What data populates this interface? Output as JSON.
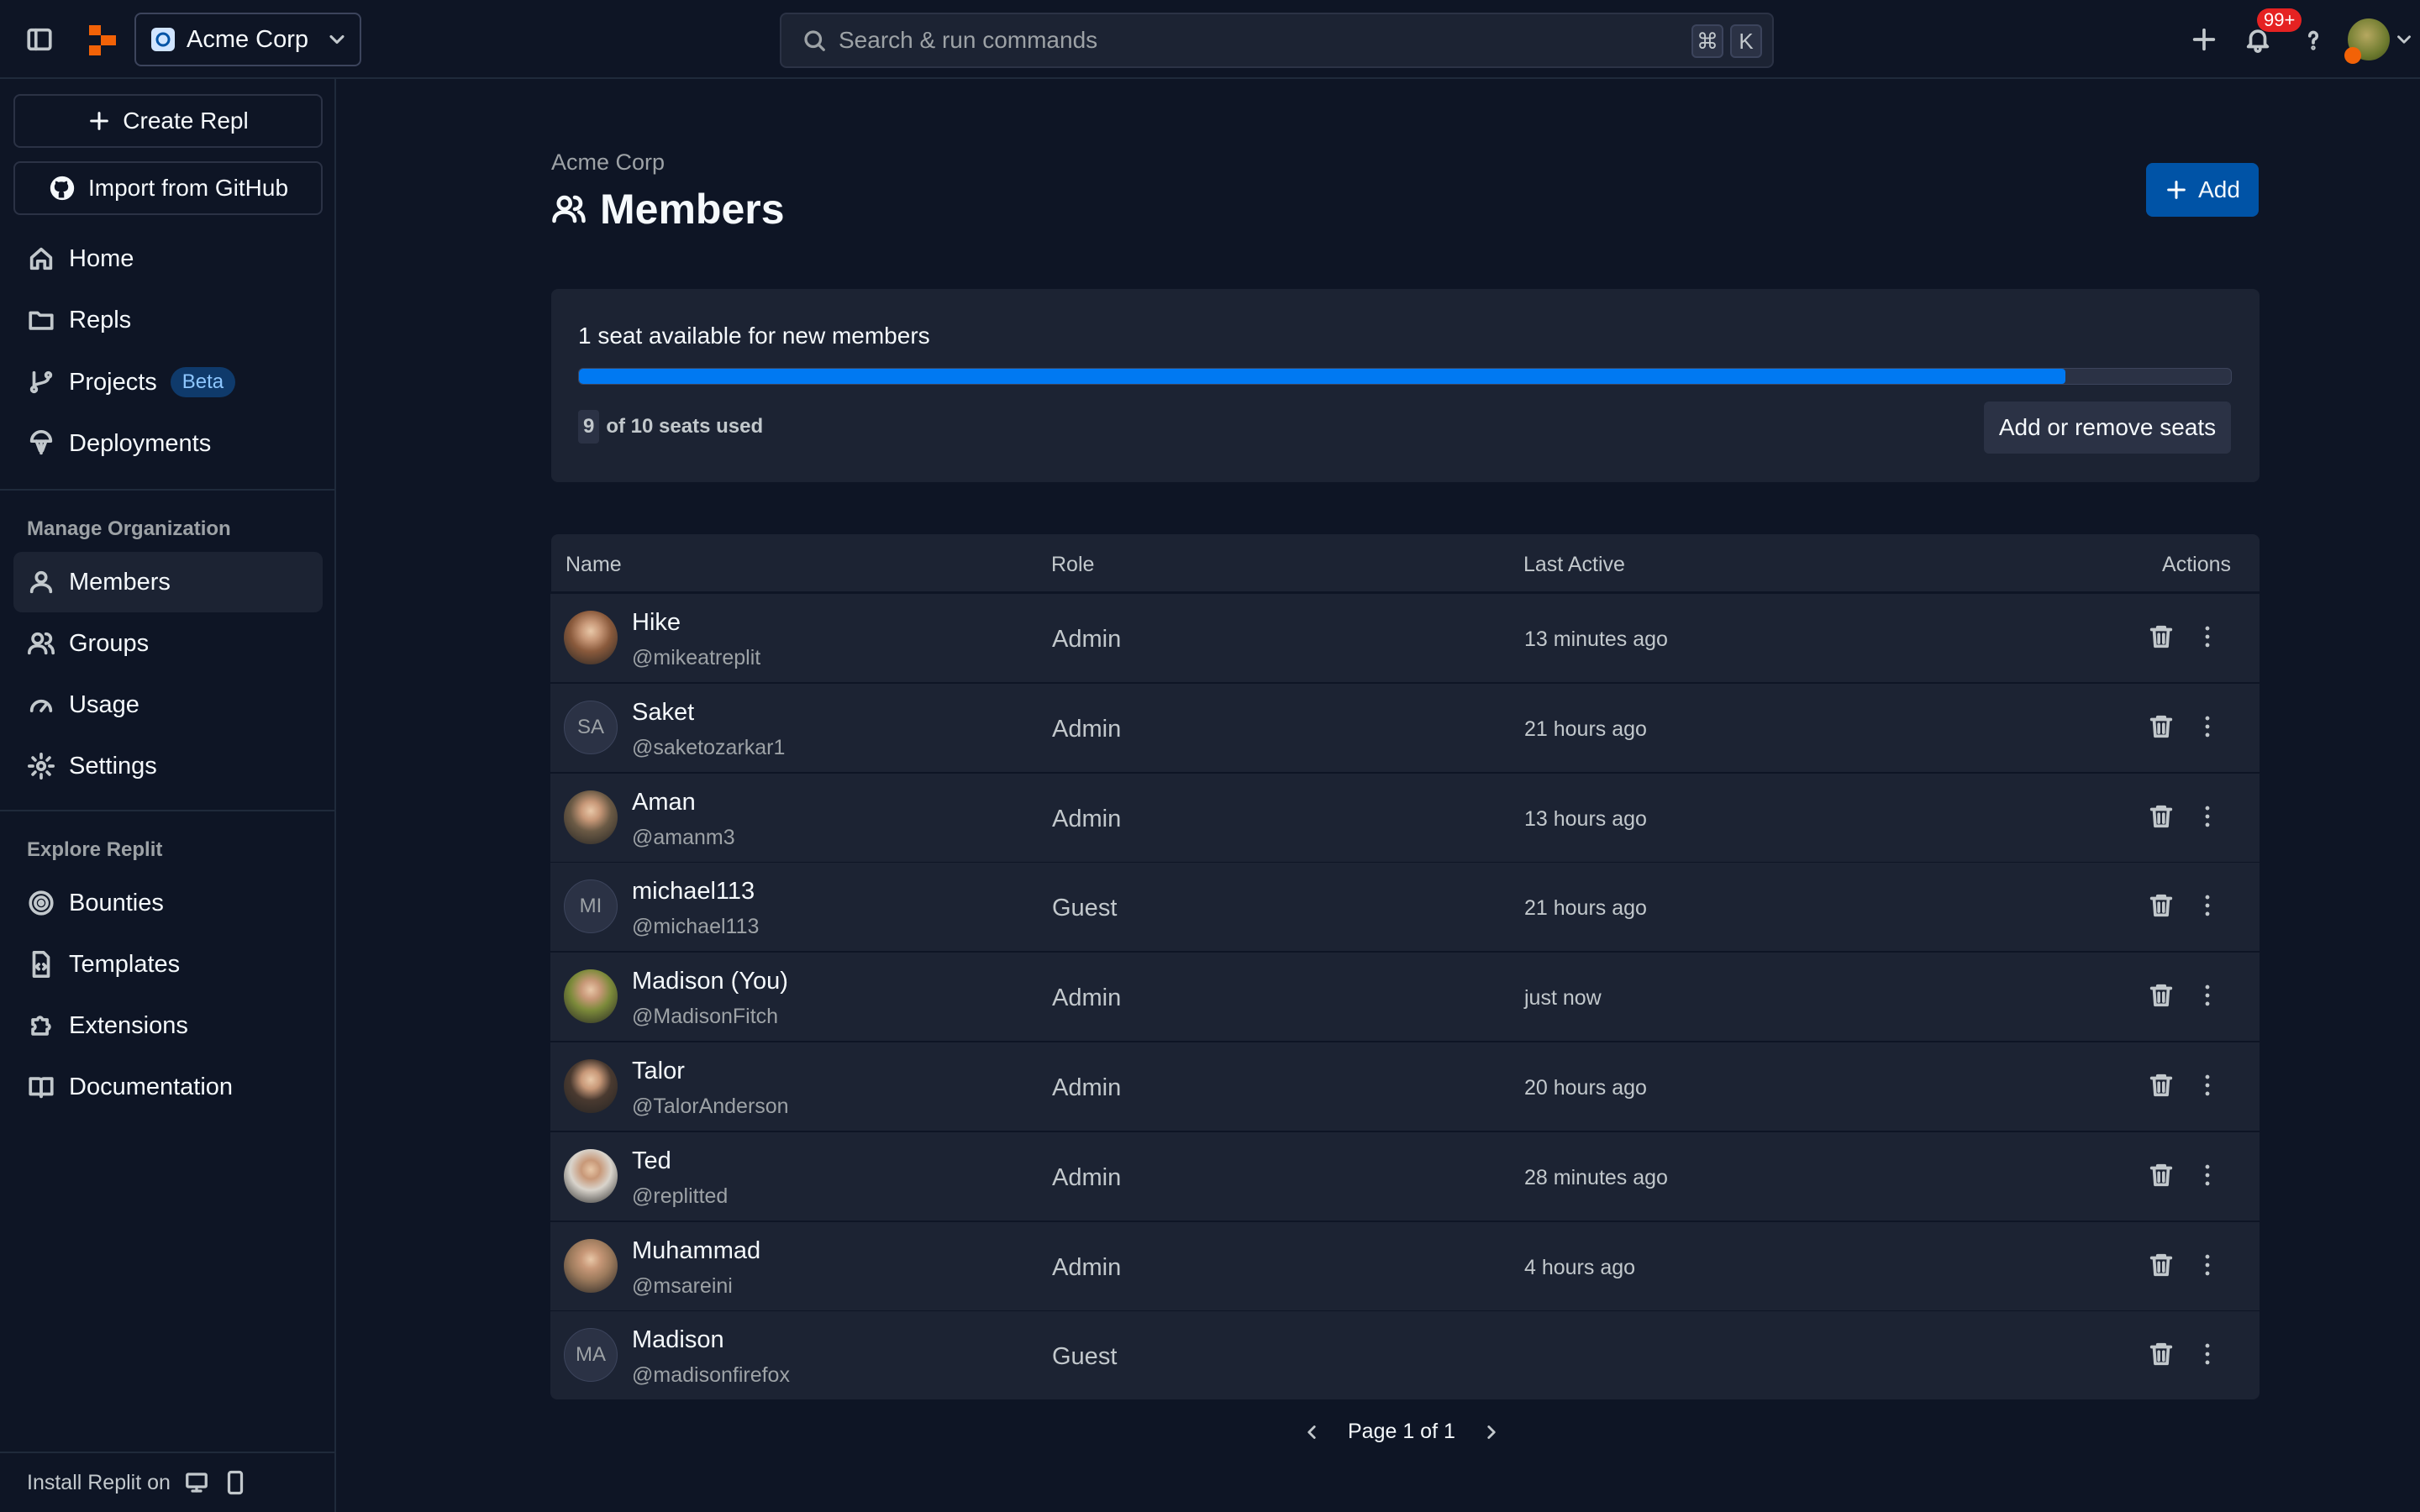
{
  "topbar": {
    "org_name": "Acme Corp",
    "search_placeholder": "Search & run commands",
    "shortcut_cmd": "⌘",
    "shortcut_key": "K",
    "notifications_count": "99+"
  },
  "sidebar": {
    "create_repl": "Create Repl",
    "import_github": "Import from GitHub",
    "nav": [
      {
        "label": "Home",
        "icon": "home-icon"
      },
      {
        "label": "Repls",
        "icon": "folder-icon"
      },
      {
        "label": "Projects",
        "icon": "branch-icon",
        "badge": "Beta"
      },
      {
        "label": "Deployments",
        "icon": "deploy-icon"
      }
    ],
    "manage_section": "Manage Organization",
    "manage": [
      {
        "label": "Members",
        "icon": "user-icon",
        "active": true
      },
      {
        "label": "Groups",
        "icon": "users-icon"
      },
      {
        "label": "Usage",
        "icon": "gauge-icon"
      },
      {
        "label": "Settings",
        "icon": "gear-icon"
      }
    ],
    "explore_section": "Explore Replit",
    "explore": [
      {
        "label": "Bounties",
        "icon": "target-icon"
      },
      {
        "label": "Templates",
        "icon": "file-code-icon"
      },
      {
        "label": "Extensions",
        "icon": "puzzle-icon"
      },
      {
        "label": "Documentation",
        "icon": "book-icon"
      }
    ],
    "install_label": "Install Replit on"
  },
  "page": {
    "breadcrumb": "Acme Corp",
    "title": "Members",
    "add_label": "Add"
  },
  "seats": {
    "available_text": "1 seat available for new members",
    "used": "9",
    "used_suffix": "of 10 seats used",
    "used_fraction": 0.9,
    "manage_label": "Add or remove seats"
  },
  "table": {
    "headers": {
      "name": "Name",
      "role": "Role",
      "last_active": "Last Active",
      "actions": "Actions"
    },
    "rows": [
      {
        "name": "Hike",
        "username": "@mikeatreplit",
        "role": "Admin",
        "last_active": "13 minutes ago",
        "avatar": "photo",
        "avatar_color": "#8a5a3c"
      },
      {
        "name": "Saket",
        "username": "@saketozarkar1",
        "role": "Admin",
        "last_active": "21 hours ago",
        "avatar": "initials",
        "initials": "SA"
      },
      {
        "name": "Aman",
        "username": "@amanm3",
        "role": "Admin",
        "last_active": "13 hours ago",
        "avatar": "photo",
        "avatar_color": "#6b5a45"
      },
      {
        "name": "michael113",
        "username": "@michael113",
        "role": "Guest",
        "last_active": "21 hours ago",
        "avatar": "initials",
        "initials": "MI"
      },
      {
        "name": "Madison (You)",
        "username": "@MadisonFitch",
        "role": "Admin",
        "last_active": "just now",
        "avatar": "photo",
        "avatar_color": "#7c8a3a"
      },
      {
        "name": "Talor",
        "username": "@TalorAnderson",
        "role": "Admin",
        "last_active": "20 hours ago",
        "avatar": "photo",
        "avatar_color": "#4a3a30"
      },
      {
        "name": "Ted",
        "username": "@replitted",
        "role": "Admin",
        "last_active": "28 minutes ago",
        "avatar": "photo",
        "avatar_color": "#d9d4cc"
      },
      {
        "name": "Muhammad",
        "username": "@msareini",
        "role": "Admin",
        "last_active": "4 hours ago",
        "avatar": "photo",
        "avatar_color": "#9c7a5c"
      },
      {
        "name": "Madison",
        "username": "@madisonfirefox",
        "role": "Guest",
        "last_active": "",
        "avatar": "initials",
        "initials": "MA"
      }
    ]
  },
  "pagination": {
    "label": "Page 1 of 1"
  },
  "colors": {
    "accent": "#0053a6",
    "progress": "#0079f2",
    "orange": "#f26207",
    "badge_red": "#e52222"
  }
}
